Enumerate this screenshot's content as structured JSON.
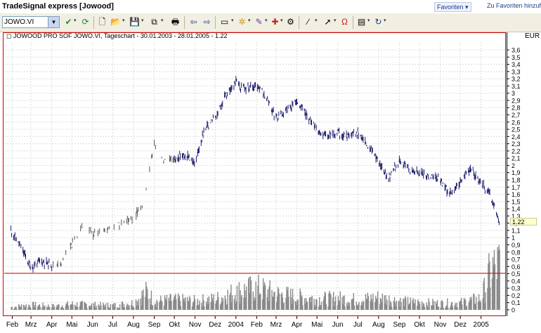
{
  "app": {
    "title": "TradeSignal express [Jowood]",
    "favorites_label": "Favoriten",
    "add_favorites_label": "Zu Favoriten hinzufüge"
  },
  "toolbar": {
    "symbol_value": "JOWO.VI",
    "icons": [
      "check-icon",
      "refresh-icon",
      "new-document-icon",
      "open-folder-icon",
      "save-icon",
      "copy-icon",
      "print-icon",
      "back-icon",
      "forward-icon",
      "chart-type-icon",
      "indicator-icon",
      "drawing-icon",
      "strategy-icon",
      "settings-icon",
      "line-tool-icon",
      "cursor-icon",
      "magnet-icon",
      "properties-icon",
      "reload-icon"
    ]
  },
  "chart": {
    "caption": "JOWOOD PRO SOF JOWO.VI, Tageschart - 30.01.2003 - 28.01.2005 - 1.22",
    "currency": "EUR",
    "last_price_label": "1.22",
    "y_ticks": [
      "3,6",
      "3,5",
      "3,4",
      "3,3",
      "3,2",
      "3,1",
      "3",
      "2,9",
      "2,8",
      "2,7",
      "2,6",
      "2,5",
      "2,4",
      "2,3",
      "2,2",
      "2,1",
      "2",
      "1,9",
      "1,8",
      "1,7",
      "1,6",
      "1,5",
      "1,4",
      "1,3",
      "1,2",
      "1,1",
      "1",
      "0,9",
      "0,8",
      "0,7",
      "0,6",
      "0,5",
      "0,4",
      "0,3",
      "0,2",
      "0,1",
      "0"
    ],
    "x_labels": [
      "Feb",
      "Mrz",
      "Apr",
      "Mai",
      "Jun",
      "Jul",
      "Aug",
      "Sep",
      "Okt",
      "Nov",
      "Dez",
      "2004",
      "Feb",
      "Mrz",
      "Apr",
      "Mai",
      "Jun",
      "Jul",
      "Aug",
      "Sep",
      "Okt",
      "Nov",
      "Dez",
      "2005"
    ]
  },
  "chart_data": {
    "type": "line",
    "title": "JOWOOD PRO SOF JOWO.VI, Tageschart - 30.01.2003 - 28.01.2005 - 1.22",
    "xlabel": "",
    "ylabel": "EUR",
    "ylim": [
      0,
      3.6
    ],
    "grid": true,
    "series": [
      {
        "name": "",
        "x": [
          "2003-01-30",
          "2003-02-15",
          "2003-03-01",
          "2003-03-15",
          "2003-04-01",
          "2003-04-15",
          "2003-05-01",
          "2003-05-15",
          "2003-06-01",
          "2003-06-15",
          "2003-07-01",
          "2003-07-15",
          "2003-08-01",
          "2003-08-15",
          "2003-09-01",
          "2003-09-15",
          "2003-10-01",
          "2003-10-15",
          "2003-11-01",
          "2003-11-15",
          "2003-12-01",
          "2003-12-15",
          "2004-01-01",
          "2004-01-15",
          "2004-02-01",
          "2004-02-15",
          "2004-03-01",
          "2004-03-15",
          "2004-04-01",
          "2004-04-15",
          "2004-05-01",
          "2004-05-15",
          "2004-06-01",
          "2004-06-15",
          "2004-07-01",
          "2004-07-15",
          "2004-08-01",
          "2004-08-15",
          "2004-09-01",
          "2004-09-15",
          "2004-10-01",
          "2004-10-15",
          "2004-11-01",
          "2004-11-15",
          "2004-12-01",
          "2004-12-15",
          "2005-01-01",
          "2005-01-15",
          "2005-01-28"
        ],
        "values": [
          1.1,
          0.85,
          0.58,
          0.68,
          0.62,
          0.65,
          0.9,
          1.15,
          1.05,
          1.12,
          1.15,
          1.18,
          1.3,
          1.45,
          2.3,
          2.05,
          2.1,
          2.15,
          2.05,
          2.5,
          2.65,
          2.95,
          3.15,
          3.05,
          3.1,
          2.95,
          2.65,
          2.75,
          2.9,
          2.7,
          2.5,
          2.4,
          2.45,
          2.4,
          2.45,
          2.3,
          2.05,
          1.8,
          2.05,
          1.95,
          1.9,
          1.85,
          1.8,
          1.6,
          1.75,
          1.95,
          1.75,
          1.6,
          1.22
        ]
      },
      {
        "name": "",
        "x": [
          "2003-01-30",
          "2003-03-01",
          "2003-04-01",
          "2003-05-01",
          "2003-06-01",
          "2003-07-01",
          "2003-08-01",
          "2003-08-20",
          "2003-09-01",
          "2003-10-01",
          "2003-11-01",
          "2003-12-01",
          "2004-01-01",
          "2004-02-01",
          "2004-03-01",
          "2004-04-01",
          "2004-05-01",
          "2004-06-01",
          "2004-07-01",
          "2004-08-01",
          "2004-09-01",
          "2004-10-01",
          "2004-11-01",
          "2004-12-01",
          "2005-01-01",
          "2005-01-15",
          "2005-01-28"
        ],
        "values": [
          0.04,
          0.07,
          0.05,
          0.08,
          0.07,
          0.06,
          0.1,
          0.25,
          0.12,
          0.14,
          0.12,
          0.15,
          0.25,
          0.3,
          0.22,
          0.18,
          0.15,
          0.16,
          0.14,
          0.17,
          0.12,
          0.1,
          0.09,
          0.1,
          0.16,
          0.55,
          0.62
        ]
      }
    ]
  }
}
